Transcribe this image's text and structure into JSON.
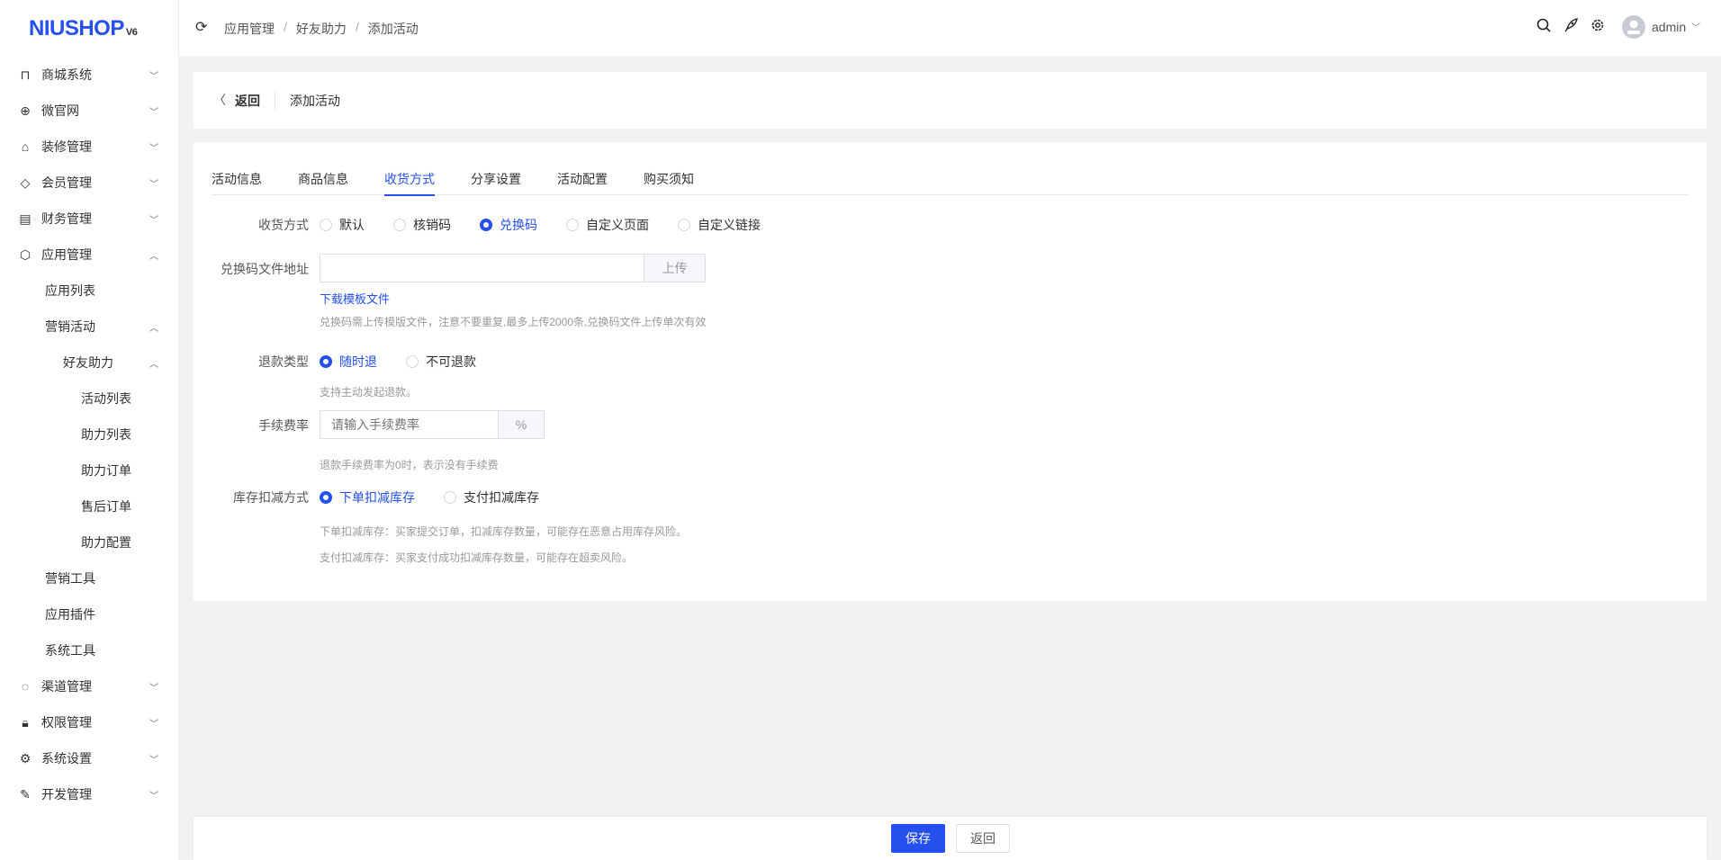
{
  "logo": {
    "text": "NIUSHOP",
    "version": "V6"
  },
  "sidebar": {
    "items": [
      {
        "label": "商城系统",
        "icon": "bag-icon",
        "expanded": false
      },
      {
        "label": "微官网",
        "icon": "globe-icon",
        "expanded": false
      },
      {
        "label": "装修管理",
        "icon": "decor-icon",
        "expanded": false
      },
      {
        "label": "会员管理",
        "icon": "diamond-icon",
        "expanded": false
      },
      {
        "label": "财务管理",
        "icon": "finance-icon",
        "expanded": false
      },
      {
        "label": "应用管理",
        "icon": "cube-icon",
        "expanded": true
      },
      {
        "label": "应用列表"
      },
      {
        "label": "营销活动",
        "expanded": true
      },
      {
        "label": "好友助力",
        "expanded": true
      },
      {
        "label": "活动列表"
      },
      {
        "label": "助力列表"
      },
      {
        "label": "助力订单"
      },
      {
        "label": "售后订单"
      },
      {
        "label": "助力配置"
      },
      {
        "label": "营销工具"
      },
      {
        "label": "应用插件"
      },
      {
        "label": "系统工具"
      },
      {
        "label": "渠道管理",
        "icon": "channel-icon",
        "expanded": false
      },
      {
        "label": "权限管理",
        "icon": "lock-icon",
        "expanded": false
      },
      {
        "label": "系统设置",
        "icon": "gear-icon",
        "expanded": false
      },
      {
        "label": "开发管理",
        "icon": "edit-icon",
        "expanded": false
      }
    ]
  },
  "header": {
    "breadcrumb": [
      "应用管理",
      "好友助力",
      "添加活动"
    ],
    "user": "admin"
  },
  "back_bar": {
    "back_label": "返回",
    "title": "添加活动"
  },
  "tabs": [
    "活动信息",
    "商品信息",
    "收货方式",
    "分享设置",
    "活动配置",
    "购买须知"
  ],
  "active_tab": 2,
  "form": {
    "delivery": {
      "label": "收货方式",
      "options": [
        "默认",
        "核销码",
        "兑换码",
        "自定义页面",
        "自定义链接"
      ],
      "selected": 2
    },
    "code_file": {
      "label": "兑换码文件地址",
      "value": "",
      "upload_label": "上传",
      "download_link": "下载模板文件",
      "hint": "兑换码需上传模版文件，注意不要重复,最多上传2000条,兑换码文件上传单次有效"
    },
    "refund": {
      "label": "退款类型",
      "options": [
        "随时退",
        "不可退款"
      ],
      "selected": 0,
      "hint": "支持主动发起退款。"
    },
    "fee": {
      "label": "手续费率",
      "placeholder": "请输入手续费率",
      "unit": "%",
      "hint": "退款手续费率为0时，表示没有手续费"
    },
    "stock": {
      "label": "库存扣减方式",
      "options": [
        "下单扣减库存",
        "支付扣减库存"
      ],
      "selected": 0,
      "hint1": "下单扣减库存：买家提交订单，扣减库存数量，可能存在恶意占用库存风险。",
      "hint2": "支付扣减库存：买家支付成功扣减库存数量，可能存在超卖风险。"
    }
  },
  "footer": {
    "save_label": "保存",
    "back_label": "返回"
  },
  "colors": {
    "accent": "#2550ee"
  }
}
